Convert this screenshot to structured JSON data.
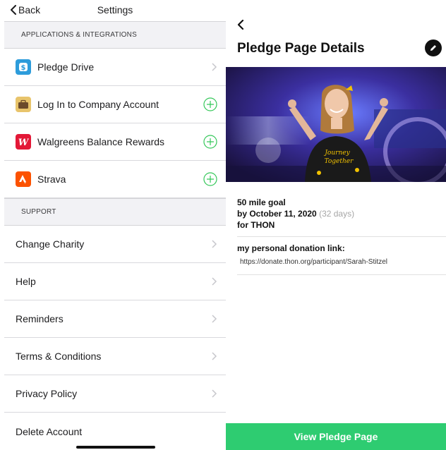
{
  "left": {
    "nav": {
      "back_label": "Back",
      "title": "Settings"
    },
    "sections": {
      "apps_header": "APPLICATIONS & INTEGRATIONS",
      "support_header": "SUPPORT"
    },
    "apps": [
      {
        "label": "Pledge Drive",
        "icon": "dollar-icon",
        "action": "chevron"
      },
      {
        "label": "Log In to Company Account",
        "icon": "briefcase-icon",
        "action": "plus"
      },
      {
        "label": "Walgreens Balance Rewards",
        "icon": "walgreens-icon",
        "action": "plus"
      },
      {
        "label": "Strava",
        "icon": "strava-icon",
        "action": "plus"
      }
    ],
    "support": [
      {
        "label": "Change Charity"
      },
      {
        "label": "Help"
      },
      {
        "label": "Reminders"
      },
      {
        "label": "Terms & Conditions"
      },
      {
        "label": "Privacy Policy"
      },
      {
        "label": "Delete Account"
      }
    ],
    "colors": {
      "section_bg": "#f2f2f5",
      "plus_green": "#34c759",
      "chevron": "#c7c7cc"
    }
  },
  "right": {
    "title": "Pledge Page Details",
    "goal_line": "50 mile goal",
    "by_prefix": "by October 11, 2020",
    "days": "(32 days)",
    "for_line": "for THON",
    "link_header": "my personal donation link:",
    "link_url": "https://donate.thon.org/participant/Sarah-Stitzel",
    "view_button": "View Pledge Page",
    "colors": {
      "button": "#2ecc71"
    }
  }
}
